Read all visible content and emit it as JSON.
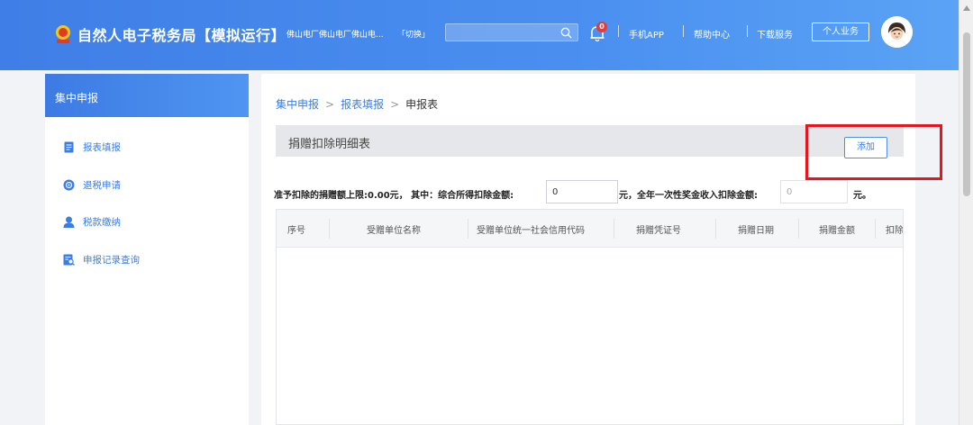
{
  "header": {
    "title": "自然人电子税务局【模拟运行】",
    "org_name": "佛山电厂佛山电厂佛山电...",
    "switch_label": "「切换」",
    "search": {
      "placeholder": "",
      "value": ""
    },
    "notification_count": "0",
    "links": [
      "手机APP",
      "帮助中心",
      "下载服务"
    ],
    "personal_button": "个人业务"
  },
  "sidebar": {
    "header": "集中申报",
    "items": [
      {
        "label": "报表填报",
        "icon": "form-icon"
      },
      {
        "label": "退税申请",
        "icon": "refund-icon"
      },
      {
        "label": "税款缴纳",
        "icon": "payment-icon"
      },
      {
        "label": "申报记录查询",
        "icon": "record-search-icon"
      }
    ]
  },
  "breadcrumb": {
    "items": [
      "集中申报",
      "报表填报",
      "申报表"
    ],
    "separator": ">"
  },
  "section": {
    "title": "捐赠扣除明细表",
    "add_button": "添加"
  },
  "deduction": {
    "label_limit": "准予扣除的捐赠额上限:0.00元， 其中：综合所得扣除金额:",
    "comprehensive_value": "0",
    "label_bonus": "元，全年一次性奖金收入扣除金额:",
    "bonus_value": "0",
    "label_unit": "元。"
  },
  "table": {
    "columns": [
      "序号",
      "受赠单位名称",
      "受赠单位统一社会信用代码",
      "捐赠凭证号",
      "捐赠日期",
      "捐赠金额",
      "扣除"
    ],
    "rows": []
  },
  "colors": {
    "header_blue": "#4a8ff0",
    "link_blue": "#3b7de3",
    "highlight_red": "#e8151f"
  }
}
